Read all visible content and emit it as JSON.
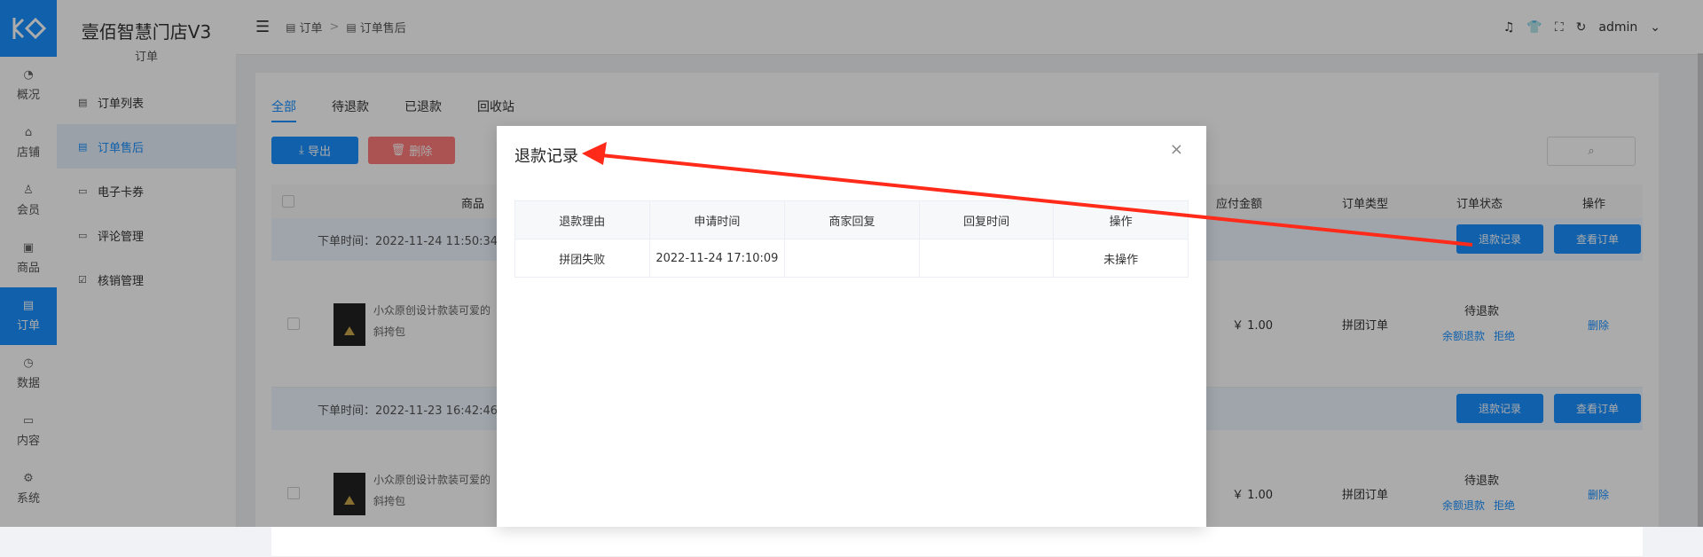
{
  "rail": {
    "items": [
      {
        "label": "概况",
        "icon": "dashboard-icon",
        "glyph": "◔"
      },
      {
        "label": "店铺",
        "icon": "store-icon",
        "glyph": "⌂"
      },
      {
        "label": "会员",
        "icon": "user-icon",
        "glyph": "♙"
      },
      {
        "label": "商品",
        "icon": "box-icon",
        "glyph": "▣"
      },
      {
        "label": "订单",
        "icon": "clipboard-icon",
        "glyph": "▤"
      },
      {
        "label": "数据",
        "icon": "pie-chart-icon",
        "glyph": "◷"
      },
      {
        "label": "内容",
        "icon": "folder-icon",
        "glyph": "▭"
      },
      {
        "label": "系统",
        "icon": "gear-icon",
        "glyph": "⚙"
      }
    ]
  },
  "submenu": {
    "brand": "壹佰智慧门店V3",
    "section": "订单",
    "items": [
      {
        "label": "订单列表",
        "glyph": "▤"
      },
      {
        "label": "订单售后",
        "glyph": "▤"
      },
      {
        "label": "电子卡券",
        "glyph": "▭"
      },
      {
        "label": "评论管理",
        "glyph": "▭"
      },
      {
        "label": "核销管理",
        "glyph": "☑"
      }
    ]
  },
  "topbar": {
    "crumb1": "订单",
    "crumb_sep": ">",
    "crumb2": "订单售后",
    "user": "admin"
  },
  "tabs": [
    "全部",
    "待退款",
    "已退款",
    "回收站"
  ],
  "toolbar": {
    "export_label": "导出",
    "delete_label": "删除"
  },
  "table": {
    "headers": {
      "product": "商品",
      "amount": "应付金额",
      "type": "订单类型",
      "status": "订单状态",
      "action": "操作"
    },
    "groups": [
      {
        "time_label": "下单时间：2022-11-24 11:50:34",
        "refund_btn": "退款记录",
        "view_btn": "查看订单",
        "product": "小众原创设计款装可爱的斜挎包",
        "amount": "￥ 1.00",
        "type": "拼团订单",
        "status": "待退款",
        "link1": "余额退款",
        "link2": "拒绝",
        "del": "删除"
      },
      {
        "time_label": "下单时间：2022-11-23 16:42:46",
        "refund_btn": "退款记录",
        "view_btn": "查看订单",
        "product": "小众原创设计款装可爱的斜挎包",
        "amount": "￥ 1.00",
        "type": "拼团订单",
        "status": "待退款",
        "link1": "余额退款",
        "link2": "拒绝",
        "del": "删除"
      }
    ]
  },
  "modal": {
    "title": "退款记录",
    "close": "×",
    "columns": [
      "退款理由",
      "申请时间",
      "商家回复",
      "回复时间",
      "操作"
    ],
    "rows": [
      [
        "拼团失败",
        "2022-11-24 17:10:09",
        "",
        "",
        "未操作"
      ]
    ]
  },
  "colors": {
    "accent": "#1890ff",
    "danger": "#ff7b7b",
    "annotation_arrow": "#ff2a1a"
  }
}
